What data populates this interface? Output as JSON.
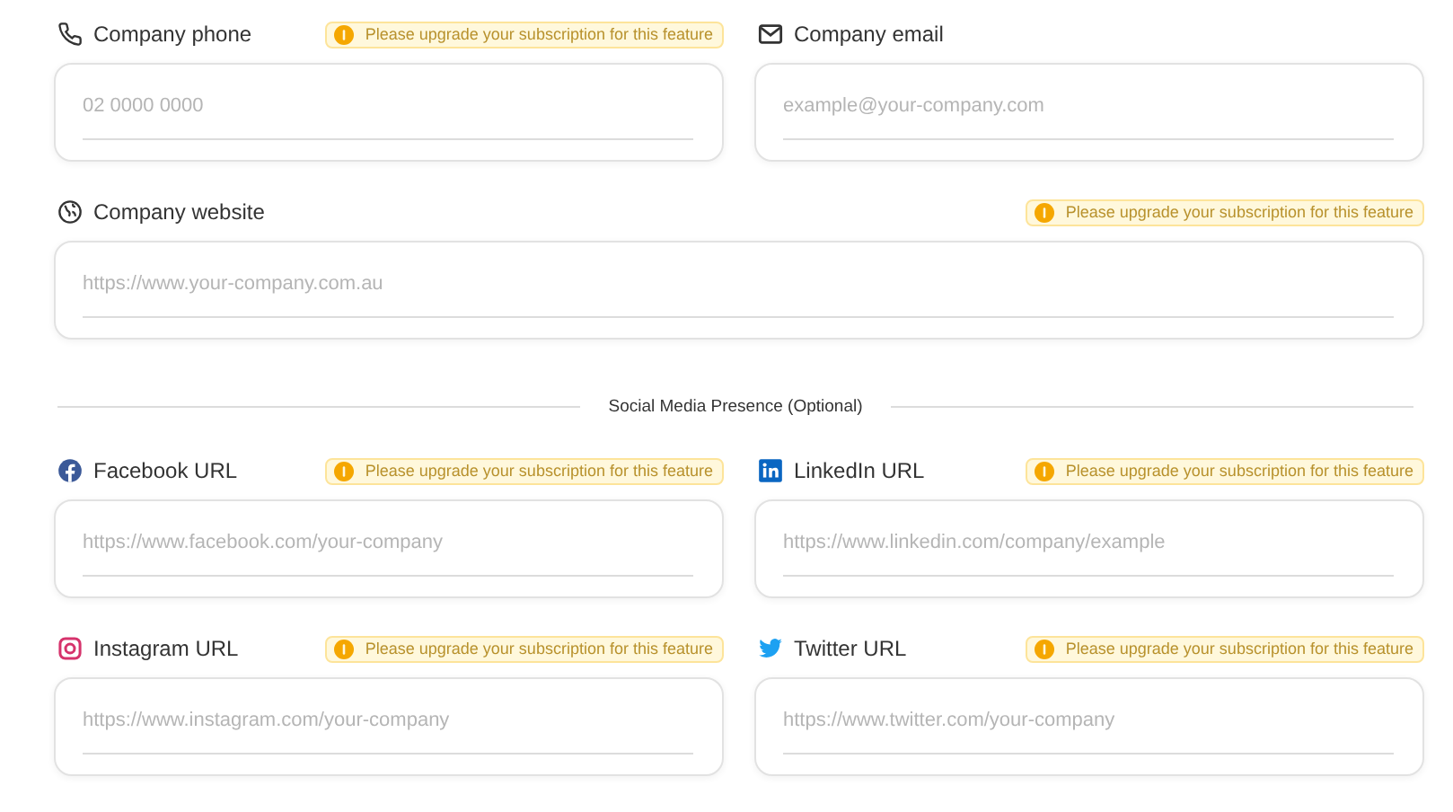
{
  "rows": [
    {
      "fields": [
        {
          "kind": "phone",
          "label": "Company phone",
          "notice": "Please upgrade your subscription for this feature",
          "placeholder": "02 0000 0000"
        },
        {
          "kind": "email",
          "label": "Company email",
          "placeholder": "example@your-company.com"
        }
      ]
    },
    {
      "fields": [
        {
          "kind": "website",
          "label": "Company website",
          "notice": "Please upgrade your subscription for this feature",
          "placeholder": "https://www.your-company.com.au"
        }
      ]
    },
    {
      "divider": "Social Media Presence (Optional)"
    },
    {
      "fields": [
        {
          "kind": "facebook",
          "label": "Facebook URL",
          "notice": "Please upgrade your subscription for this feature",
          "placeholder": "https://www.facebook.com/your-company"
        },
        {
          "kind": "linkedin",
          "label": "LinkedIn URL",
          "notice": "Please upgrade your subscription for this feature",
          "placeholder": "https://www.linkedin.com/company/example"
        }
      ]
    },
    {
      "fields": [
        {
          "kind": "instagram",
          "label": "Instagram URL",
          "notice": "Please upgrade your subscription for this feature",
          "placeholder": "https://www.instagram.com/your-company"
        },
        {
          "kind": "twitter",
          "label": "Twitter URL",
          "notice": "Please upgrade your subscription for this feature",
          "placeholder": "https://www.twitter.com/your-company"
        }
      ]
    }
  ]
}
